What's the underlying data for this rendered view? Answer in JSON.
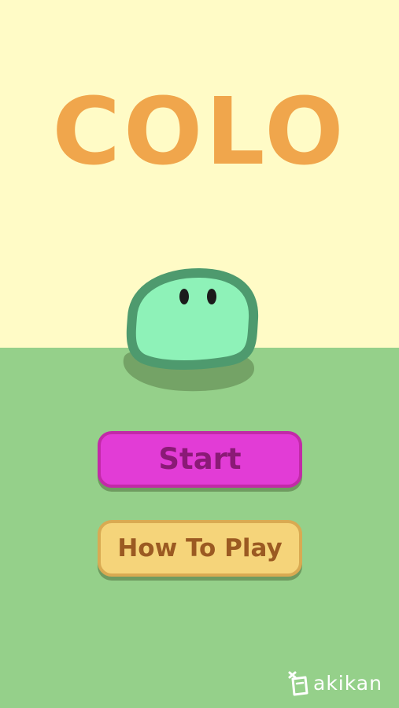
{
  "game": {
    "title": "COLO"
  },
  "menu": {
    "start_label": "Start",
    "howto_label": "How To Play"
  },
  "brand": {
    "name": "akikan",
    "icon": "can-icon"
  },
  "colors": {
    "sky": "#fffbc6",
    "ground": "#95d08a",
    "title": "#f0a64c",
    "blob_fill": "#8ef2b8",
    "blob_outline": "#4e9a6e",
    "start_button": "#e23cd6",
    "howto_button": "#f5d47a"
  }
}
